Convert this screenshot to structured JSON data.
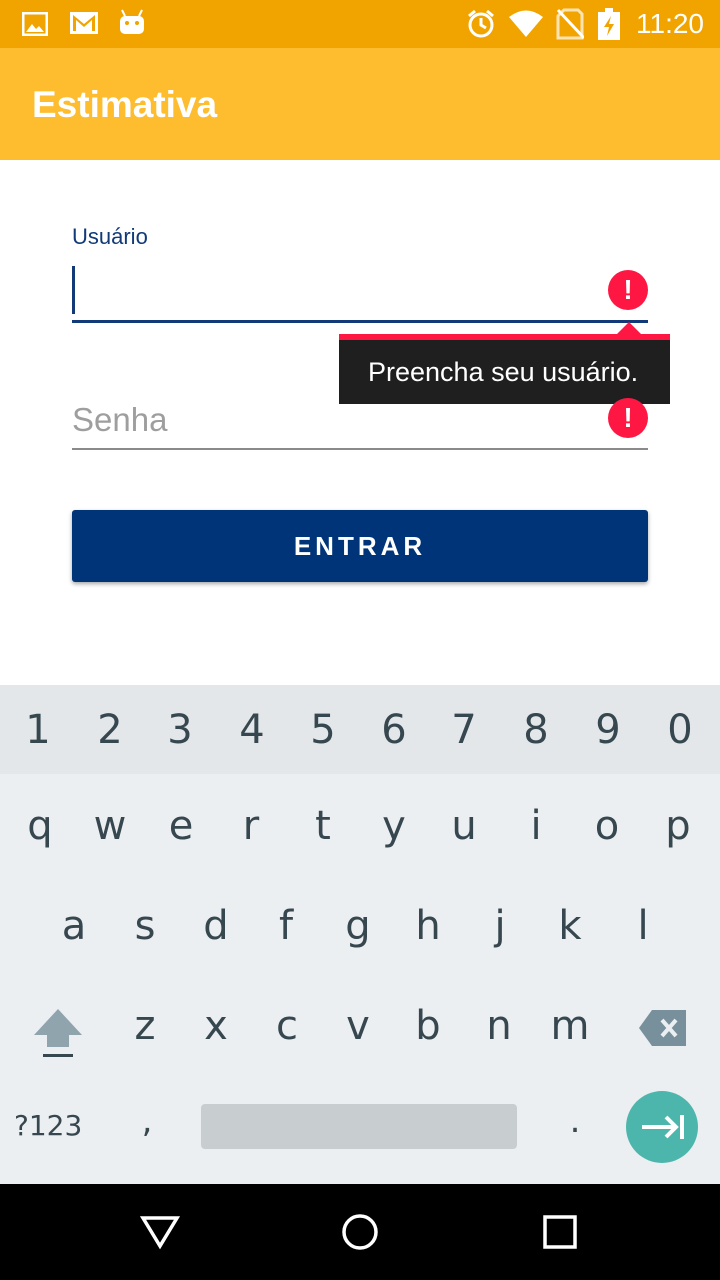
{
  "status_bar": {
    "time": "11:20"
  },
  "toolbar": {
    "title": "Estimativa"
  },
  "login": {
    "user_label": "Usuário",
    "password_placeholder": "Senha",
    "error_tooltip": "Preencha seu usuário.",
    "error_mark": "!",
    "submit_label": "ENTRAR"
  },
  "keyboard": {
    "number_row": [
      "1",
      "2",
      "3",
      "4",
      "5",
      "6",
      "7",
      "8",
      "9",
      "0"
    ],
    "row1": [
      "q",
      "w",
      "e",
      "r",
      "t",
      "y",
      "u",
      "i",
      "o",
      "p"
    ],
    "row2": [
      "a",
      "s",
      "d",
      "f",
      "g",
      "h",
      "j",
      "k",
      "l"
    ],
    "row3": [
      "z",
      "x",
      "c",
      "v",
      "b",
      "n",
      "m"
    ],
    "symbols_label": "?123",
    "comma": ",",
    "period": "."
  },
  "colors": {
    "status": "#F1A400",
    "toolbar": "#FDBD2F",
    "accent": "#003479",
    "error": "#FF1744",
    "enter": "#4DB6AC"
  }
}
